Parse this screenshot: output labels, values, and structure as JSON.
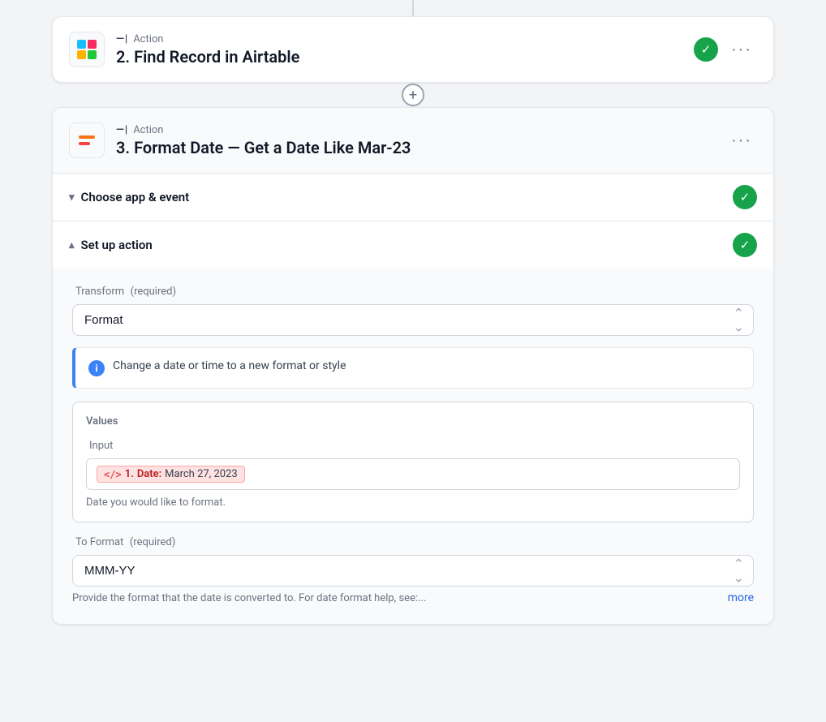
{
  "page": {
    "background": "#f3f4f6"
  },
  "card1": {
    "action_prefix": "Action",
    "title": "2. Find Record in Airtable",
    "check_visible": true
  },
  "connector": {
    "plus_symbol": "+"
  },
  "card2": {
    "action_prefix": "Action",
    "title": "3. Format Date — Get a Date Like Mar-23",
    "section1": {
      "label": "Choose app & event",
      "state": "collapsed",
      "check_visible": true
    },
    "section2": {
      "label": "Set up action",
      "state": "expanded",
      "check_visible": true
    },
    "setup": {
      "transform_label": "Transform",
      "transform_required": "(required)",
      "transform_value": "Format",
      "info_text": "Change a date or time to a new format or style",
      "values_legend": "Values",
      "input_label": "Input",
      "input_tag_code": "</>",
      "input_tag_number": "1.",
      "input_tag_key": "Date:",
      "input_tag_value": "March 27, 2023",
      "input_hint": "Date you would like to format.",
      "to_format_label": "To Format",
      "to_format_required": "(required)",
      "to_format_value": "MMM-YY",
      "to_format_hint": "Provide the format that the date is converted to. For date format help, see:...",
      "more_label": "more"
    }
  }
}
